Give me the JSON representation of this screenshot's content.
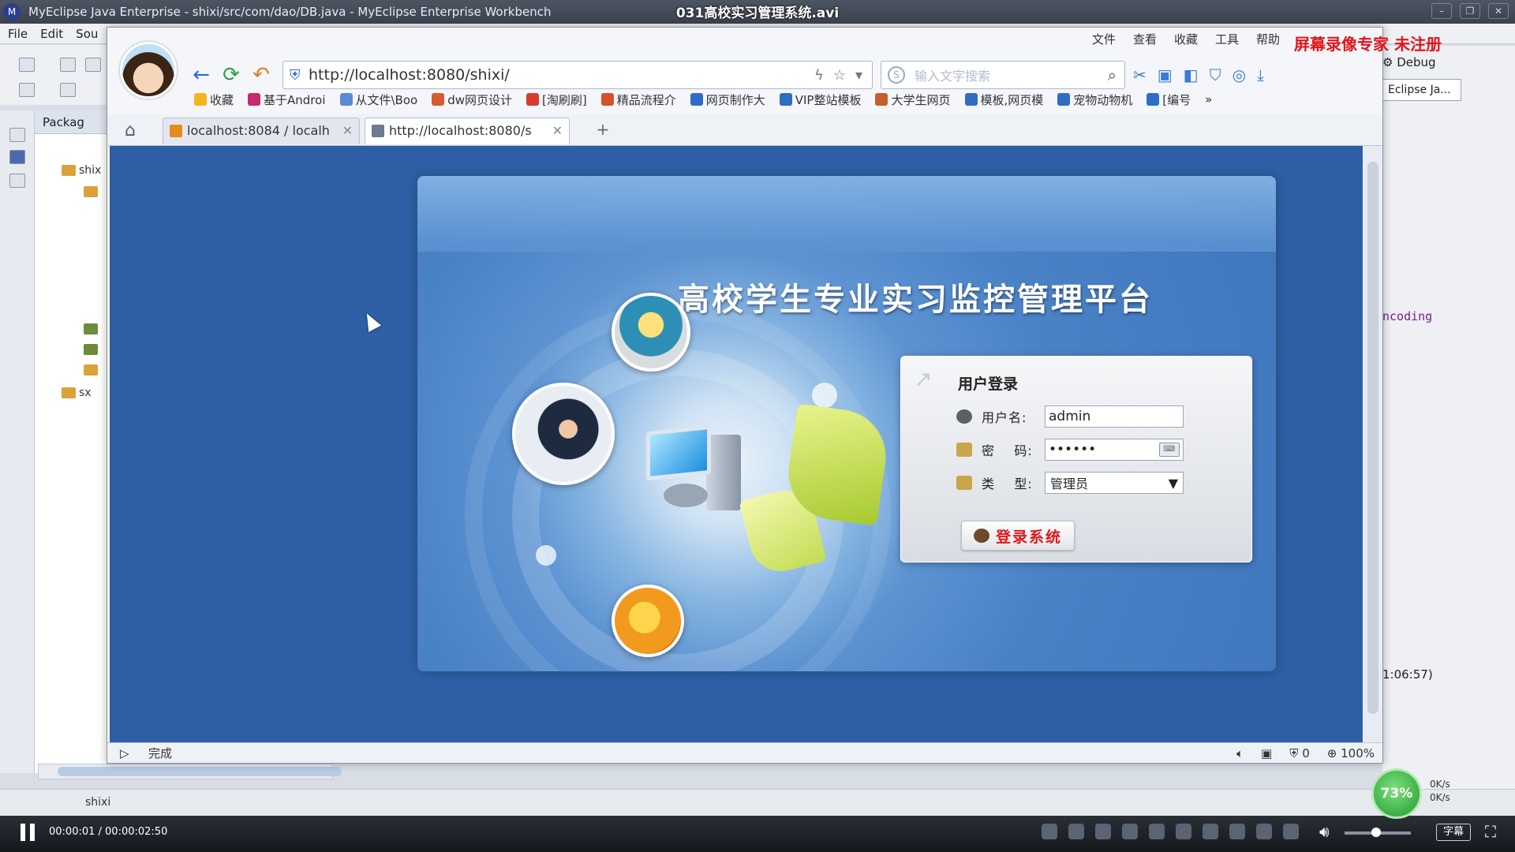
{
  "video": {
    "title": "031高校实习管理系统.avi",
    "time": "00:00:01 / 00:00:02:50",
    "subtitle_btn": "字幕",
    "recorder_brand": "屏幕录像专家  未注册"
  },
  "eclipse": {
    "window_title": "MyEclipse Java Enterprise - shixi/src/com/dao/DB.java - MyEclipse Enterprise Workbench",
    "menu": [
      "File",
      "Edit",
      "Sou"
    ],
    "package_tab": "Packag",
    "tree": [
      "shix",
      "sx"
    ],
    "perspective": "Debug",
    "editor_tab": "Eclipse Ja...",
    "editor_peek": "ncoding",
    "time_peek": "1:06:57)",
    "status_project": "shixi"
  },
  "browser": {
    "menu": [
      "文件",
      "查看",
      "收藏",
      "工具",
      "帮助"
    ],
    "address": "http://localhost:8080/shixi/",
    "search_placeholder": "输入文字搜索",
    "bookmarks": [
      {
        "label": "收藏",
        "color": "#f2b51d"
      },
      {
        "label": "基于Androi",
        "color": "#c8286e"
      },
      {
        "label": "从文件\\Boo",
        "color": "#5b8ad6"
      },
      {
        "label": "dw网页设计",
        "color": "#d65b2e"
      },
      {
        "label": "[淘刷刷]",
        "color": "#d83c2c"
      },
      {
        "label": "精品流程介",
        "color": "#d8502c"
      },
      {
        "label": "网页制作大",
        "color": "#2f6dc5"
      },
      {
        "label": "VIP整站模板",
        "color": "#2f6dc5"
      },
      {
        "label": "大学生网页",
        "color": "#c75d2b"
      },
      {
        "label": "模板,网页模",
        "color": "#2f6dc5"
      },
      {
        "label": "宠物动物机",
        "color": "#2f6dc5"
      },
      {
        "label": "[编号",
        "color": "#2f6dc5"
      }
    ],
    "tabs": [
      {
        "label": "localhost:8084 / localh",
        "color": "#e38b1e"
      },
      {
        "label": "http://localhost:8080/s",
        "color": "#6b7a90"
      }
    ],
    "status": {
      "done": "完成",
      "count": "0",
      "zoom": "100%"
    }
  },
  "login_page": {
    "title": "高校学生专业实习监控管理平台",
    "box_heading": "用户登录",
    "username_label": "用户名:",
    "username_value": "admin",
    "password_label": "密    码:",
    "password_value": "••••••",
    "type_label": "类    型:",
    "type_value": "管理员",
    "login_button": "登录系统"
  },
  "system": {
    "perf": "73%",
    "net_up": "0K/s",
    "net_down": "0K/s"
  },
  "colors": {
    "page_bg": "#2e5fa4",
    "button_text": "#e0181c",
    "title_text": "#ffffff"
  }
}
